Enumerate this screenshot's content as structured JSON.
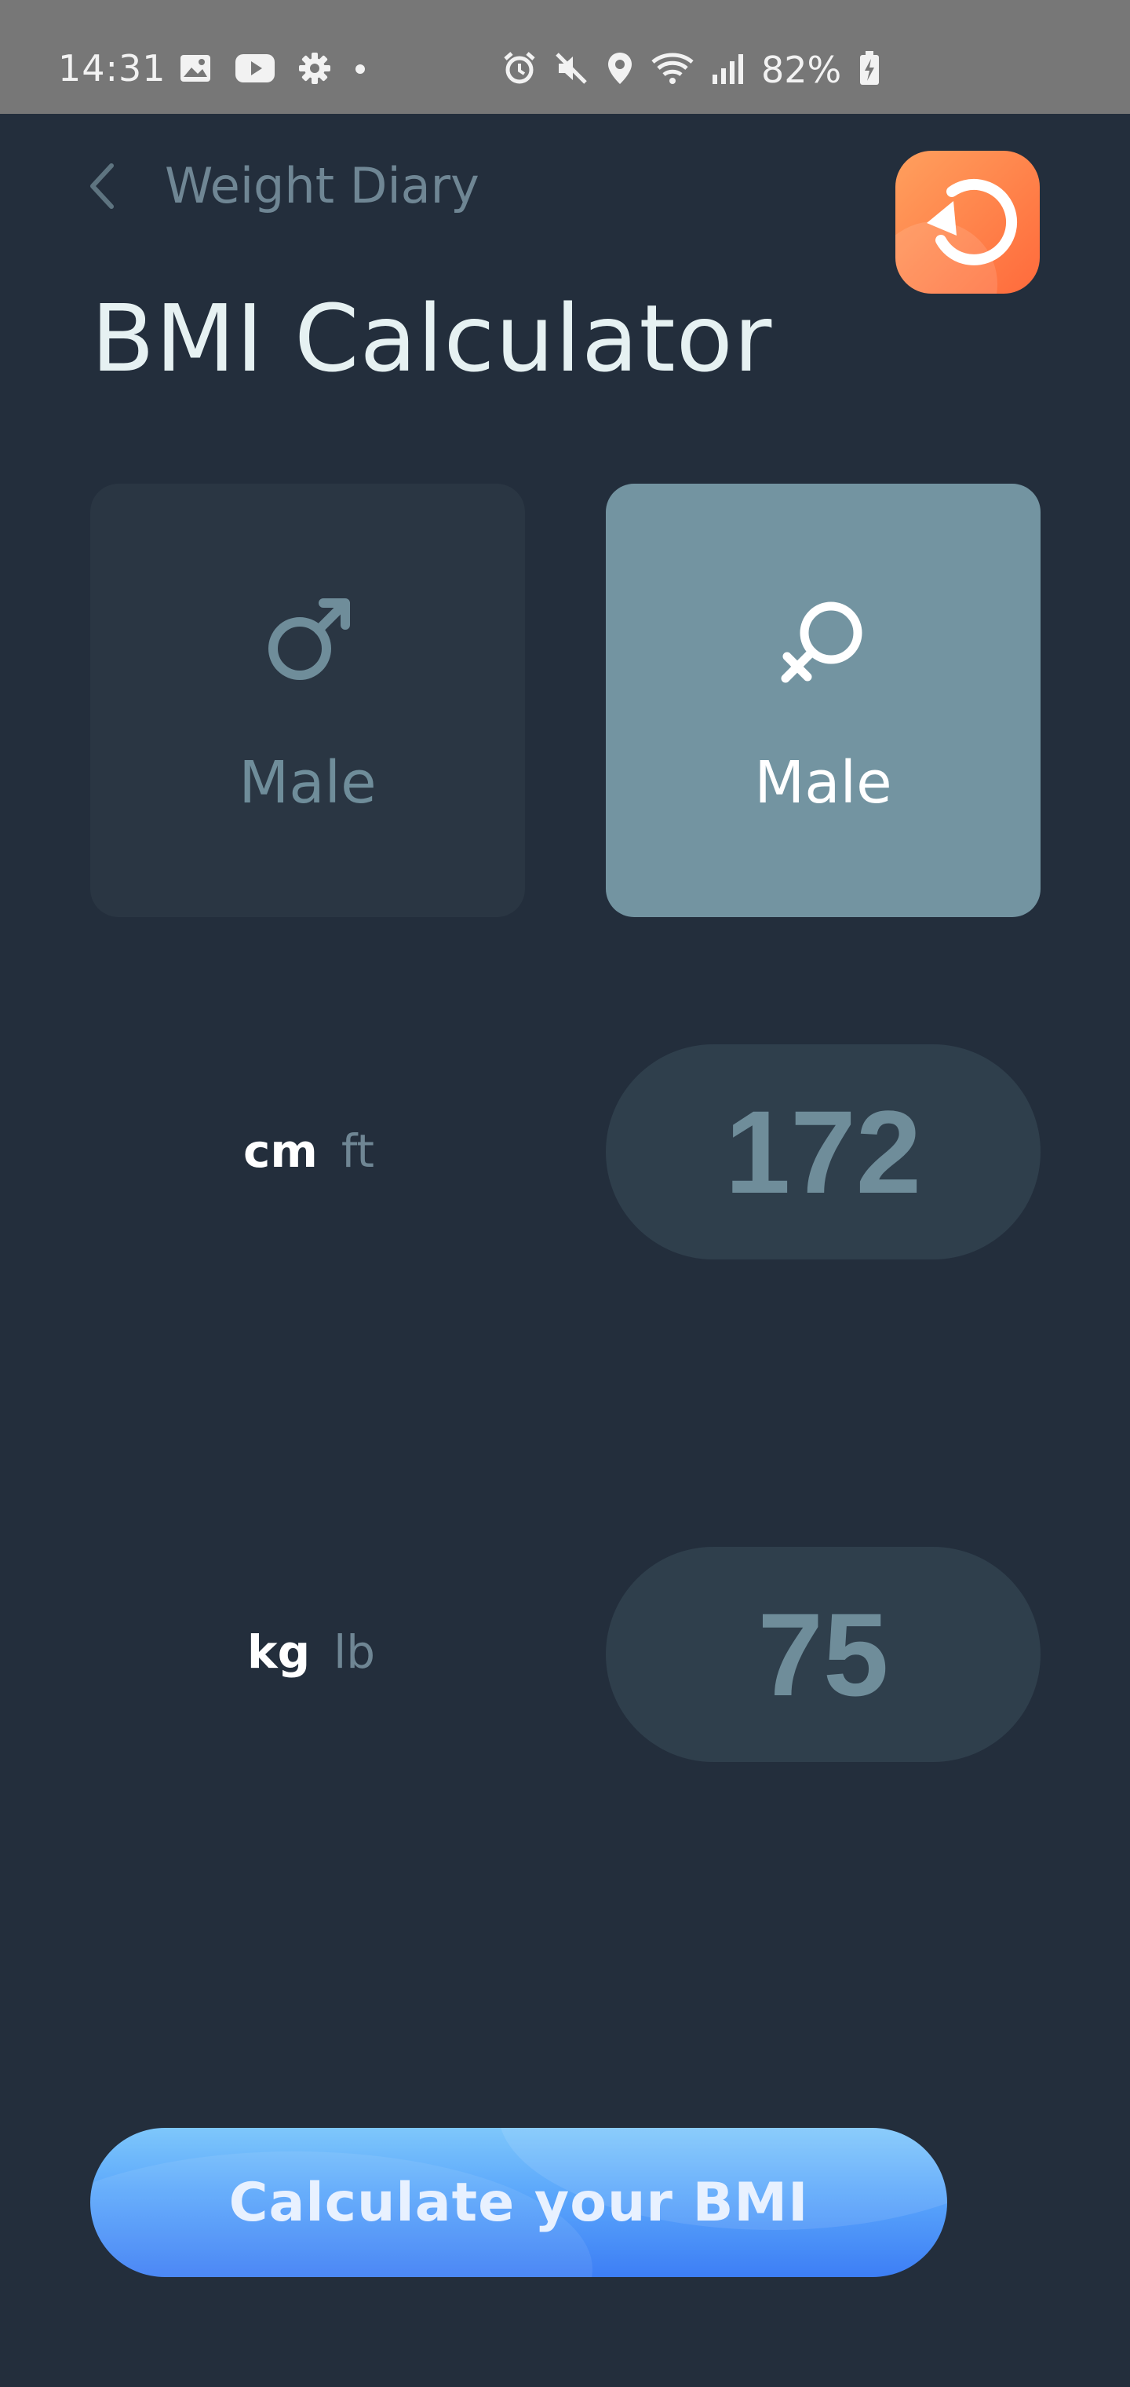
{
  "status_bar": {
    "time": "14:31",
    "left_icons": [
      "gallery-icon",
      "youtube-icon",
      "settings-gear-icon",
      "dot-icon"
    ],
    "right_icons": [
      "alarm-icon",
      "mute-icon",
      "location-icon",
      "wifi-icon",
      "signal-icon",
      "battery-charging-icon"
    ],
    "battery_percent": "82%"
  },
  "header": {
    "back_label": "Weight Diary",
    "back_icon": "chevron-left-icon",
    "reset_icon": "reset-icon",
    "reset_color": "#ff7a45"
  },
  "title": "BMI Calculator",
  "gender": {
    "options": [
      {
        "label": "Male",
        "icon": "male-symbol-icon",
        "selected": false
      },
      {
        "label": "Male",
        "icon": "female-symbol-icon",
        "selected": true
      }
    ],
    "selected_color": "#7394a1"
  },
  "height": {
    "unit_active": "cm",
    "unit_inactive": "ft",
    "value": "172"
  },
  "weight": {
    "unit_active": "kg",
    "unit_inactive": "lb",
    "value": "75"
  },
  "calculate_button": {
    "label": "Calculate your BMI",
    "color": "#5aa6fb"
  }
}
